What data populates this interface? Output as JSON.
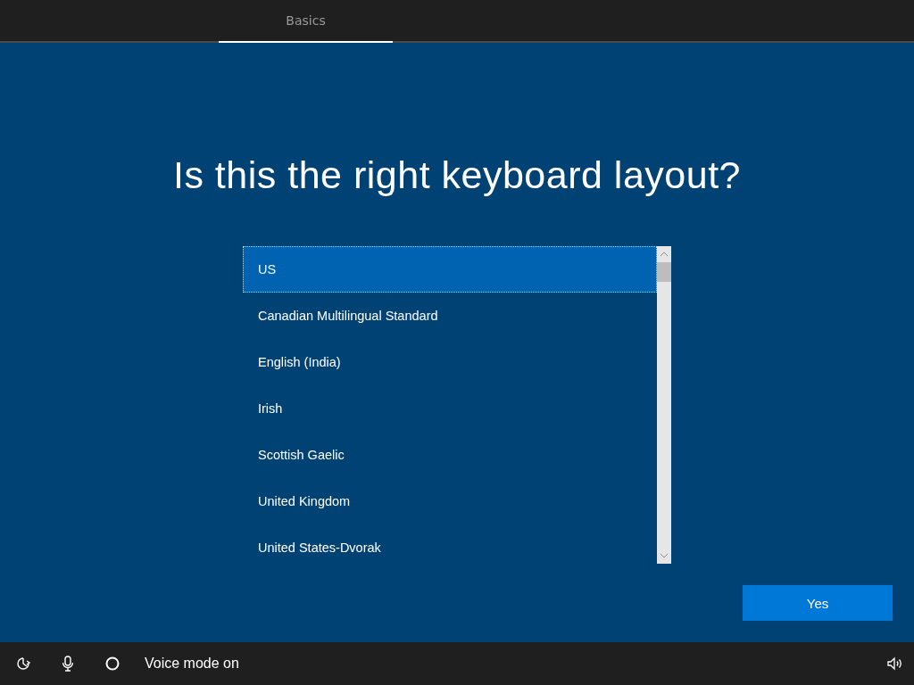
{
  "header": {
    "tabs": [
      {
        "label": "Basics",
        "selected": true
      }
    ]
  },
  "title": "Is this the right keyboard layout?",
  "layouts": [
    {
      "label": "US",
      "selected": true
    },
    {
      "label": "Canadian Multilingual Standard",
      "selected": false
    },
    {
      "label": "English (India)",
      "selected": false
    },
    {
      "label": "Irish",
      "selected": false
    },
    {
      "label": "Scottish Gaelic",
      "selected": false
    },
    {
      "label": "United Kingdom",
      "selected": false
    },
    {
      "label": "United States-Dvorak",
      "selected": false
    }
  ],
  "buttons": [
    "Yes"
  ],
  "taskbar": {
    "status": "Voice mode on"
  }
}
